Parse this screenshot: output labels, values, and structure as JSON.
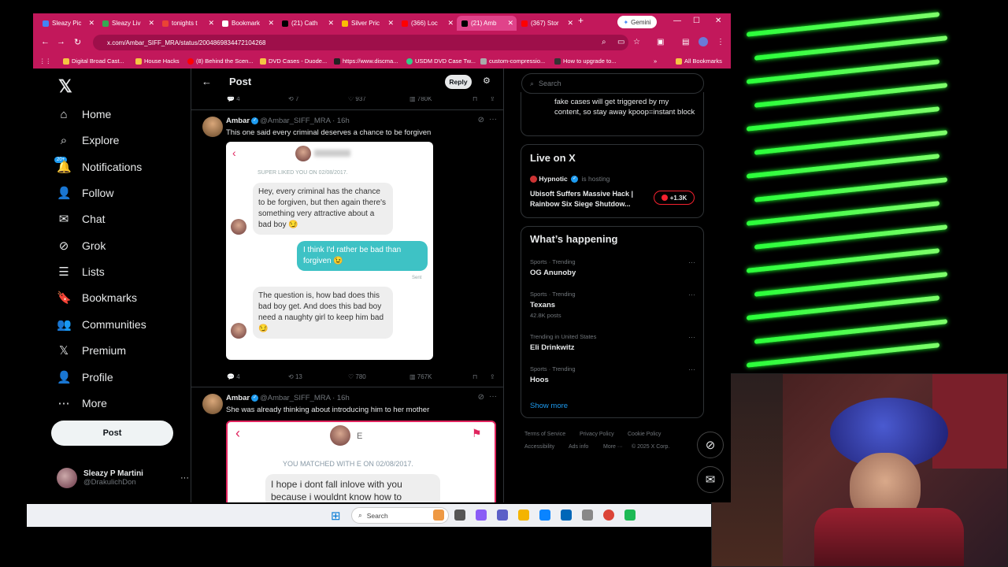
{
  "browser": {
    "tabs": [
      {
        "label": "Sleazy Pic",
        "color": "#4285f4"
      },
      {
        "label": "Sleazy Liv",
        "color": "#34a853"
      },
      {
        "label": "tonights t",
        "color": "#ea4335"
      },
      {
        "label": "Bookmark",
        "color": "#ffffff"
      },
      {
        "label": "(21) Cath",
        "color": "#000000"
      },
      {
        "label": "Silver Pric",
        "color": "#fbbc05"
      },
      {
        "label": "(366) Loc",
        "color": "#ff0000"
      },
      {
        "label": "(21) Amb",
        "color": "#000000"
      },
      {
        "label": "(367) Stor",
        "color": "#ff0000"
      }
    ],
    "gemini_label": "Gemini",
    "url": "x.com/Ambar_SIFF_MRA/status/2004869834472104268",
    "bookmarks": [
      "Digital Broad Cast...",
      "House Hacks",
      "(8) Behind the Scen...",
      "DVD Cases - Duode...",
      "https://www.discma...",
      "USDM DVD Case Tw...",
      "custom-compressio...",
      "How to upgrade to..."
    ],
    "all_bookmarks": "All Bookmarks",
    "accent": "#c2185b"
  },
  "sidebar": {
    "items": [
      {
        "label": "Home",
        "icon": "⌂"
      },
      {
        "label": "Explore",
        "icon": "⌕"
      },
      {
        "label": "Notifications",
        "icon": "🔔"
      },
      {
        "label": "Follow",
        "icon": "👤"
      },
      {
        "label": "Chat",
        "icon": "✉"
      },
      {
        "label": "Grok",
        "icon": "⊘"
      },
      {
        "label": "Lists",
        "icon": "☰"
      },
      {
        "label": "Bookmarks",
        "icon": "🔖"
      },
      {
        "label": "Communities",
        "icon": "👥"
      },
      {
        "label": "Premium",
        "icon": "𝕏"
      },
      {
        "label": "Profile",
        "icon": "👤"
      },
      {
        "label": "More",
        "icon": "⋯"
      }
    ],
    "notif_badge": "20+",
    "post_label": "Post",
    "account_name": "Sleazy P Martini",
    "account_handle": "@DrakulichDon"
  },
  "header": {
    "title": "Post",
    "reply_label": "Reply"
  },
  "top_actions": {
    "replies": "4",
    "reposts": "7",
    "likes": "937",
    "views": "780K"
  },
  "tweet1": {
    "name": "Ambar",
    "handle": "@Ambar_SIFF_MRA",
    "time": "· 16h",
    "text": "This one said every criminal deserves a chance to be forgiven",
    "card": {
      "meta": "SUPER LIKED YOU ON 02/08/2017.",
      "msg1": "Hey, every criminal has the chance to be forgiven, but then again there's something very attractive about a bad boy 😏",
      "msg2": "I think I'd rather be bad than forgiven 😉",
      "sent": "Sent",
      "msg3": "The question is, how bad does this bad boy get. And does this bad boy need a naughty girl to keep him bad 😏"
    },
    "actions": {
      "replies": "4",
      "reposts": "13",
      "likes": "780",
      "views": "767K"
    }
  },
  "tweet2": {
    "name": "Ambar",
    "handle": "@Ambar_SIFF_MRA",
    "time": "· 16h",
    "text": "She was already thinking about introducing him to her mother",
    "card": {
      "meta": "YOU MATCHED WITH E      ON 02/08/2017.",
      "msg1": "I hope i dont fall inlove with you because i wouldnt know how to"
    }
  },
  "rightcol": {
    "search_placeholder": "Search",
    "prev_text": "fake cases will get triggered by my content, so stay away kpoop=instant block",
    "live_title": "Live on X",
    "live_host": "Hypnotic",
    "live_host_suffix": "is hosting",
    "live_stream_title": "Ubisoft Suffers Massive Hack | Rainbow Six Siege Shutdow...",
    "live_count": "+1.3K",
    "happening_title": "What’s happening",
    "trends": [
      {
        "meta": "Sports · Trending",
        "name": "OG Anunoby",
        "posts": ""
      },
      {
        "meta": "Sports · Trending",
        "name": "Texans",
        "posts": "42.8K posts"
      },
      {
        "meta": "Trending in United States",
        "name": "Eli Drinkwitz",
        "posts": ""
      },
      {
        "meta": "Sports · Trending",
        "name": "Hoos",
        "posts": ""
      }
    ],
    "show_more": "Show more",
    "footer": [
      "Terms of Service",
      "Privacy Policy",
      "Cookie Policy",
      "Accessibility",
      "Ads info",
      "More ···",
      "© 2025 X Corp."
    ]
  },
  "taskbar": {
    "search": "Search"
  }
}
